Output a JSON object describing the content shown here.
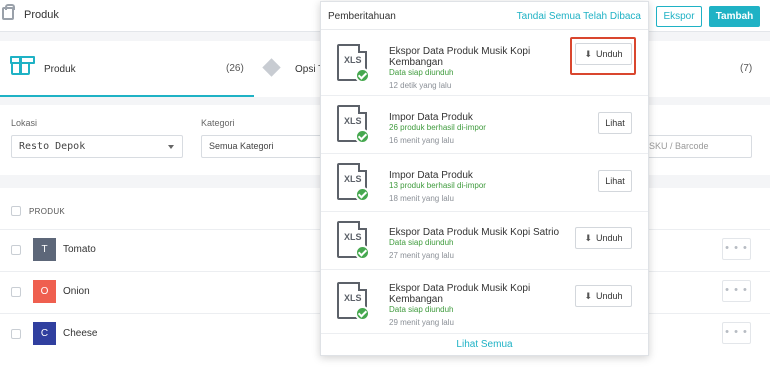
{
  "topbar": {
    "title": "Produk",
    "export_label": "Ekspor",
    "add_label": "Tambah"
  },
  "tabs": {
    "produk": {
      "label": "Produk",
      "count": "(26)"
    },
    "opsi": {
      "label": "Opsi T",
      "count": "(7)"
    }
  },
  "filters": {
    "location_label": "Lokasi",
    "location_value": "Resto Depok",
    "category_label": "Kategori",
    "category_value": "Semua Kategori",
    "search_placeholder": "SKU / Barcode"
  },
  "table": {
    "header": "PRODUK",
    "rows": [
      {
        "initial": "T",
        "name": "Tomato",
        "color": "#5d6779"
      },
      {
        "initial": "O",
        "name": "Onion",
        "color": "#ef5f4f"
      },
      {
        "initial": "C",
        "name": "Cheese",
        "color": "#303f9f"
      }
    ],
    "more_label": "• • •"
  },
  "notifications": {
    "title": "Pemberitahuan",
    "mark_all_read": "Tandai Semua Telah Dibaca",
    "file_type": "XLS",
    "items": [
      {
        "title": "Ekspor Data Produk Musik Kopi Kembangan",
        "status": "Data siap diunduh",
        "time": "12 detik yang lalu",
        "action": "Unduh"
      },
      {
        "title": "Impor Data Produk",
        "status": "26 produk berhasil di-impor",
        "time": "16 menit yang lalu",
        "action": "Lihat"
      },
      {
        "title": "Impor Data Produk",
        "status": "13 produk berhasil di-impor",
        "time": "18 menit yang lalu",
        "action": "Lihat"
      },
      {
        "title": "Ekspor Data Produk Musik Kopi Satrio",
        "status": "Data siap diunduh",
        "time": "27 menit yang lalu",
        "action": "Unduh"
      },
      {
        "title": "Ekspor Data Produk Musik Kopi Kembangan",
        "status": "Data siap diunduh",
        "time": "29 menit yang lalu",
        "action": "Unduh"
      }
    ],
    "see_all": "Lihat Semua"
  },
  "colors": {
    "accent": "#1fb2c5",
    "success": "#3f9b3d",
    "highlight": "#d9462e"
  }
}
